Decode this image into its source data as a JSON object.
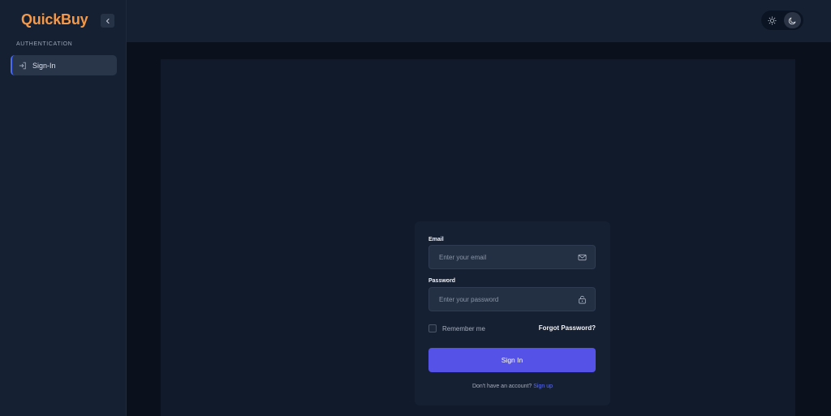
{
  "sidebar": {
    "brand": "QuickBuy",
    "section_label": "AUTHENTICATION",
    "items": [
      {
        "label": "Sign-In",
        "icon": "sign-in-icon",
        "active": true
      }
    ],
    "collapse_icon": "chevron-left-icon"
  },
  "header": {
    "theme_toggle": {
      "options": [
        "sun-icon",
        "moon-icon"
      ],
      "selected": "dark"
    }
  },
  "form": {
    "email_label": "Email",
    "email_placeholder": "Enter your email",
    "email_value": "",
    "password_label": "Password",
    "password_placeholder": "Enter your password",
    "password_value": "",
    "remember_label": "Remember me",
    "remember_checked": false,
    "forgot_label": "Forgot Password?",
    "submit_label": "Sign In",
    "signup_prompt": "Don't have an account?",
    "signup_link": "Sign up"
  },
  "colors": {
    "brand": "#f3994a",
    "primary": "#5552e8",
    "link": "#5b6cf2",
    "sidebar_bg": "#152033",
    "main_bg": "#0a111c",
    "card_bg": "#162033"
  }
}
